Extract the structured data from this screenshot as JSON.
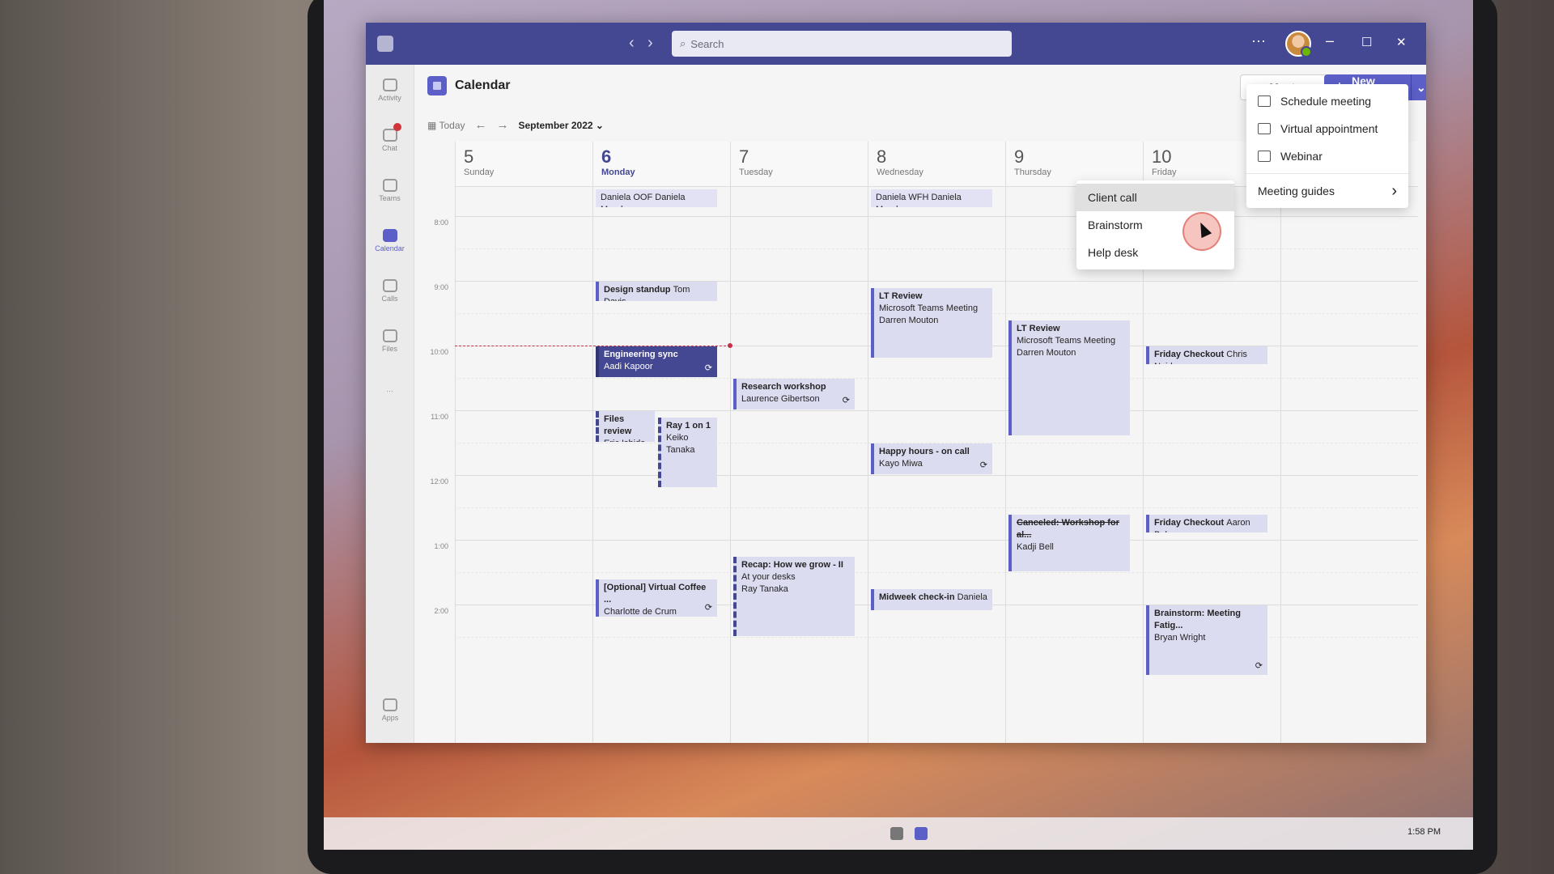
{
  "titlebar": {
    "search_placeholder": "Search",
    "more_label": "···",
    "minimize": "–",
    "maximize": "☐",
    "close": "✕",
    "back": "‹",
    "forward": "›"
  },
  "rail": {
    "items": [
      "Activity",
      "Chat",
      "Teams",
      "Calendar",
      "Calls",
      "Files",
      "···",
      "Apps"
    ]
  },
  "header": {
    "title": "Calendar",
    "meet_now": "Meet now",
    "new_meeting": "New meeting"
  },
  "toolbar": {
    "today": "Today",
    "month": "September 2022"
  },
  "days": [
    {
      "num": "5",
      "name": "Sunday"
    },
    {
      "num": "6",
      "name": "Monday",
      "today": true
    },
    {
      "num": "7",
      "name": "Tuesday"
    },
    {
      "num": "8",
      "name": "Wednesday"
    },
    {
      "num": "9",
      "name": "Thursday"
    },
    {
      "num": "10",
      "name": "Friday"
    },
    {
      "num": "",
      "name": ""
    }
  ],
  "hours": [
    "8:00",
    "9:00",
    "10:00",
    "11:00",
    "12:00",
    "1:00",
    "2:00"
  ],
  "current_time": "10:00",
  "all_day": [
    {
      "day": 1,
      "text": "Daniela OOF  Daniela Mandera"
    },
    {
      "day": 3,
      "text": "Daniela WFH  Daniela Mandera"
    }
  ],
  "events": [
    {
      "day": 1,
      "start": 9.0,
      "end": 9.33,
      "title": "Design standup",
      "inline": "Tom Davis"
    },
    {
      "day": 1,
      "start": 10.0,
      "end": 10.5,
      "title": "Engineering sync",
      "lines": [
        "Aadi Kapoor"
      ],
      "style": "dark",
      "recurring": true
    },
    {
      "day": 1,
      "start": 11.0,
      "end": 11.5,
      "title": "Files review",
      "lines": [
        "Eric Ishida"
      ],
      "style": "tentative",
      "half": 0
    },
    {
      "day": 1,
      "start": 11.1,
      "end": 12.2,
      "title": "Ray 1 on 1",
      "lines": [
        "Keiko Tanaka"
      ],
      "style": "tentative",
      "half": 1
    },
    {
      "day": 1,
      "start": 13.6,
      "end": 14.2,
      "title": "[Optional] Virtual Coffee ...",
      "lines": [
        "Charlotte de Crum"
      ],
      "recurring": true
    },
    {
      "day": 2,
      "start": 10.5,
      "end": 11.0,
      "title": "Research workshop",
      "lines": [
        "Laurence Gibertson"
      ],
      "recurring": true
    },
    {
      "day": 2,
      "start": 13.25,
      "end": 14.5,
      "title": "Recap: How we grow - II",
      "lines": [
        "At your desks",
        "Ray Tanaka"
      ],
      "style": "tentative"
    },
    {
      "day": 3,
      "start": 9.1,
      "end": 10.2,
      "title": "LT Review",
      "lines": [
        "Microsoft Teams Meeting",
        "Darren Mouton"
      ]
    },
    {
      "day": 3,
      "start": 11.5,
      "end": 12.0,
      "title": "Happy hours - on call",
      "lines": [
        "Kayo Miwa"
      ],
      "recurring": true
    },
    {
      "day": 3,
      "start": 13.75,
      "end": 14.1,
      "title": "Midweek check-in",
      "inline": "Daniela ..."
    },
    {
      "day": 4,
      "start": 9.6,
      "end": 11.4,
      "title": "LT Review",
      "lines": [
        "Microsoft Teams Meeting",
        "Darren Mouton"
      ]
    },
    {
      "day": 4,
      "start": 12.6,
      "end": 13.5,
      "title": "Canceled: Workshop for al...",
      "lines": [
        "Kadji Bell"
      ],
      "style": "canceled"
    },
    {
      "day": 5,
      "start": 10.0,
      "end": 10.3,
      "title": "Friday Checkout",
      "inline": "Chris Naid..."
    },
    {
      "day": 5,
      "start": 12.6,
      "end": 12.9,
      "title": "Friday Checkout",
      "inline": "Aaron Bak..."
    },
    {
      "day": 5,
      "start": 14.0,
      "end": 15.1,
      "title": "Brainstorm: Meeting Fatig...",
      "lines": [
        "Bryan Wright"
      ],
      "recurring": true
    }
  ],
  "new_meeting_menu": {
    "items": [
      {
        "label": "Schedule meeting",
        "icon": "calendar-icon"
      },
      {
        "label": "Virtual appointment",
        "icon": "virtual-appointment-icon"
      },
      {
        "label": "Webinar",
        "icon": "webinar-icon"
      }
    ],
    "guides": "Meeting guides"
  },
  "guides_submenu": {
    "items": [
      "Client call",
      "Brainstorm",
      "Help desk"
    ],
    "hovered": "Client call"
  },
  "taskbar": {
    "time": "1:58 PM"
  },
  "colors": {
    "brand": "#444791",
    "accent": "#5b5fc7",
    "event_bg": "#dcdcf1",
    "now_line": "#c4314b"
  }
}
